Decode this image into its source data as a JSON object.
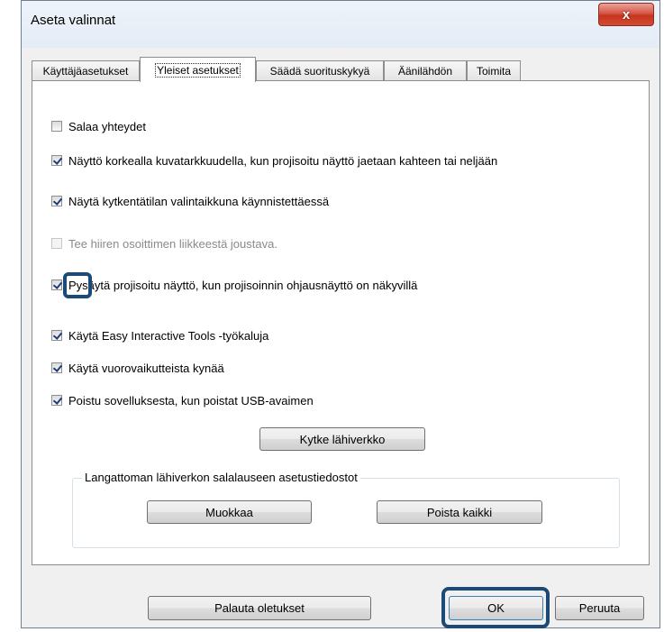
{
  "window": {
    "title": "Aseta valinnat",
    "close_label": "x"
  },
  "tabs": [
    {
      "label": "Käyttäjäasetukset"
    },
    {
      "label": "Yleiset asetukset"
    },
    {
      "label": "Säädä suorituskykyä"
    },
    {
      "label": "Äänilähdön"
    },
    {
      "label": "Toimita"
    }
  ],
  "options": [
    {
      "label": "Salaa yhteydet",
      "checked": false,
      "enabled": true
    },
    {
      "label": "Näyttö korkealla kuvatarkkuudella, kun projisoitu näyttö jaetaan kahteen tai neljään",
      "checked": true,
      "enabled": true
    },
    {
      "label": "Näytä kytkentätilan valintaikkuna käynnistettäessä",
      "checked": true,
      "enabled": true
    },
    {
      "label": "Tee hiiren osoittimen liikkeestä joustava.",
      "checked": false,
      "enabled": false
    },
    {
      "label": "Pysäytä projisoitu näyttö, kun projisoinnin ohjausnäyttö on näkyvillä",
      "checked": true,
      "enabled": true
    },
    {
      "label": "Käytä Easy Interactive Tools -työkaluja",
      "checked": true,
      "enabled": true
    },
    {
      "label": "Käytä vuorovaikutteista kynää",
      "checked": true,
      "enabled": true
    },
    {
      "label": "Poistu sovelluksesta, kun poistat USB-avaimen",
      "checked": true,
      "enabled": true
    }
  ],
  "buttons": {
    "connect_lan": "Kytke lähiverkko",
    "edit": "Muokkaa",
    "delete_all": "Poista kaikki",
    "restore_defaults": "Palauta oletukset",
    "ok": "OK",
    "cancel": "Peruuta"
  },
  "wlan_group": {
    "legend": "Langattoman lähiverkon salalauseen asetustiedostot"
  }
}
